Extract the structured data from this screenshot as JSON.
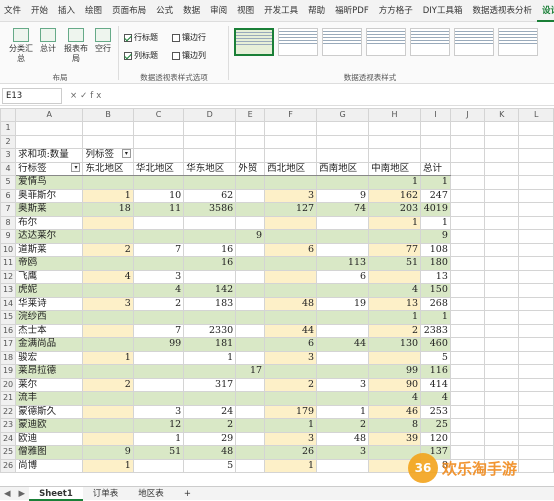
{
  "menu": [
    "文件",
    "开始",
    "插入",
    "绘图",
    "页面布局",
    "公式",
    "数据",
    "审阅",
    "视图",
    "开发工具",
    "帮助",
    "福昕PDF",
    "方方格子",
    "DIY工具箱",
    "数据透视表分析",
    "设计"
  ],
  "ribbon": {
    "btn_subtotal": "分类汇总",
    "btn_total": "总计",
    "btn_report_layout": "报表布局",
    "btn_blank_rows": "空行",
    "group_layout": "布局",
    "chk_row_headers": "行标题",
    "chk_banded_rows": "镶边行",
    "chk_col_headers": "列标题",
    "chk_banded_cols": "镶边列",
    "group_style_options": "数据透视表样式选项",
    "group_styles": "数据透视表样式"
  },
  "formula_bar": {
    "name_box": "E13",
    "fx": "×✓fx"
  },
  "columns": [
    "A",
    "B",
    "C",
    "D",
    "E",
    "F",
    "G",
    "H",
    "I",
    "J",
    "K",
    "L"
  ],
  "pivot": {
    "title_label": "求和项:数量",
    "col_label": "列标签",
    "row_label": "行标签",
    "headers": [
      "东北地区",
      "华北地区",
      "华东地区",
      "外贸",
      "西北地区",
      "西南地区",
      "中南地区",
      "总计"
    ],
    "rows": [
      {
        "name": "爱情鸟",
        "v": [
          "",
          "",
          "",
          "",
          "",
          "",
          "1",
          "1"
        ]
      },
      {
        "name": "奥菲斯尔",
        "v": [
          "1",
          "10",
          "62",
          "",
          "3",
          "9",
          "162",
          "247"
        ]
      },
      {
        "name": "奥斯莱",
        "v": [
          "18",
          "11",
          "3586",
          "",
          "127",
          "74",
          "203",
          "4019"
        ]
      },
      {
        "name": "布尔",
        "v": [
          "",
          "",
          "",
          "",
          "",
          "",
          "1",
          "1"
        ]
      },
      {
        "name": "达达莱尔",
        "v": [
          "",
          "",
          "",
          "9",
          "",
          "",
          "",
          "9"
        ]
      },
      {
        "name": "道斯莱",
        "v": [
          "2",
          "7",
          "16",
          "",
          "6",
          "",
          "77",
          "108"
        ]
      },
      {
        "name": "帝鸥",
        "v": [
          "",
          "",
          "16",
          "",
          "",
          "113",
          "51",
          "180"
        ]
      },
      {
        "name": "飞鹰",
        "v": [
          "4",
          "3",
          "",
          "",
          "",
          "6",
          "",
          "13"
        ]
      },
      {
        "name": "虎妮",
        "v": [
          "",
          "4",
          "142",
          "",
          "",
          "",
          "4",
          "150"
        ]
      },
      {
        "name": "华莱诗",
        "v": [
          "3",
          "2",
          "183",
          "",
          "48",
          "19",
          "13",
          "268"
        ]
      },
      {
        "name": "浣纱西",
        "v": [
          "",
          "",
          "",
          "",
          "",
          "",
          "1",
          "1"
        ]
      },
      {
        "name": "杰士本",
        "v": [
          "",
          "7",
          "2330",
          "",
          "44",
          "",
          "2",
          "2383"
        ]
      },
      {
        "name": "金满尚品",
        "v": [
          "",
          "99",
          "181",
          "",
          "6",
          "44",
          "130",
          "460"
        ]
      },
      {
        "name": "骏宏",
        "v": [
          "1",
          "",
          "1",
          "",
          "3",
          "",
          "",
          "5"
        ]
      },
      {
        "name": "莱昂拉德",
        "v": [
          "",
          "",
          "",
          "17",
          "",
          "",
          "99",
          "116"
        ]
      },
      {
        "name": "莱尔",
        "v": [
          "2",
          "",
          "317",
          "",
          "2",
          "3",
          "90",
          "414"
        ]
      },
      {
        "name": "流丰",
        "v": [
          "",
          "",
          "",
          "",
          "",
          "",
          "4",
          "4"
        ]
      },
      {
        "name": "蒙德斯久",
        "v": [
          "",
          "3",
          "24",
          "",
          "179",
          "1",
          "46",
          "253"
        ]
      },
      {
        "name": "蒙迪欧",
        "v": [
          "",
          "12",
          "2",
          "",
          "1",
          "2",
          "8",
          "25"
        ]
      },
      {
        "name": "欧迪",
        "v": [
          "",
          "1",
          "29",
          "",
          "3",
          "48",
          "39",
          "120"
        ]
      },
      {
        "name": "僧雅图",
        "v": [
          "9",
          "51",
          "48",
          "",
          "26",
          "3",
          "",
          "137"
        ]
      },
      {
        "name": "尚博",
        "v": [
          "1",
          "",
          "5",
          "",
          "1",
          "",
          "",
          "8"
        ]
      }
    ]
  },
  "sheets": [
    "Sheet1",
    "订单表",
    "地区表"
  ],
  "watermark": {
    "text": "欢乐淘手游",
    "glyph": "36"
  },
  "colors": {
    "accent": "#1a7f37",
    "band_green": "#d9e8c6",
    "band_yellow": "#fdf0c8"
  }
}
